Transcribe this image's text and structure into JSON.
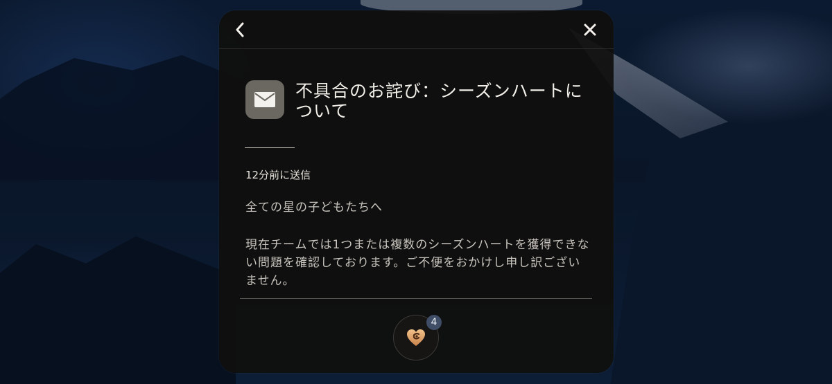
{
  "header": {
    "back_icon": "chevron-left-icon",
    "close_icon": "close-icon"
  },
  "mail": {
    "icon": "envelope-icon",
    "title": "不具合のお詫び：シーズンハートについて",
    "sent_time": "12分前に送信",
    "greeting": "全ての星の子どもたちへ",
    "body": "現在チームでは1つまたは複数のシーズンハートを獲得できない問題を確認しております。ご不便をおかけし申し訳ございません。"
  },
  "reward": {
    "icon": "season-heart-icon",
    "count": "4"
  },
  "colors": {
    "panel_bg": "#100f0e",
    "text_primary": "#f2efe9",
    "badge_bg": "#3f4e66",
    "heart_gold": "#e2a86a"
  }
}
